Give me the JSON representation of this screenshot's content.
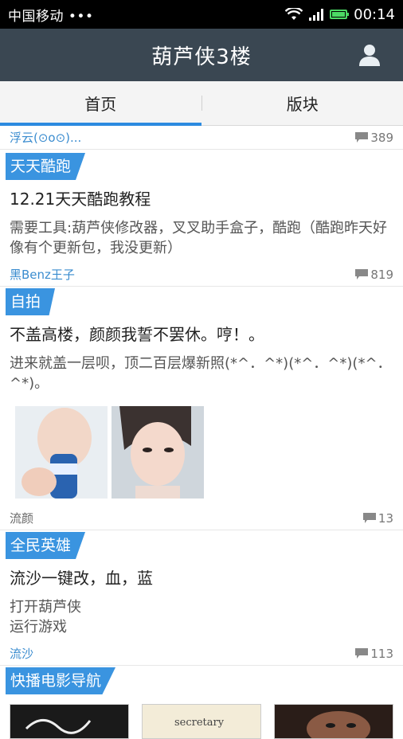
{
  "status_bar": {
    "carrier": "中国移动 •••",
    "time": "00:14"
  },
  "header": {
    "title": "葫芦侠3楼"
  },
  "tabs": [
    {
      "label": "首页"
    },
    {
      "label": "版块"
    }
  ],
  "posts": [
    {
      "author": "浮云(⊙o⊙)...",
      "comments": "389",
      "tag": "天天酷跑",
      "title": "12.21天天酷跑教程",
      "body": "需要工具:葫芦侠修改器，叉叉助手盒子，酷跑（酷跑昨天好像有个更新包，我没更新）"
    },
    {
      "author": "黑Benz王子",
      "comments": "819",
      "tag": "自拍",
      "title": "不盖高楼，颜颜我誓不罢休。哼！。",
      "body": "进来就盖一层呗，顶二百层爆新照(*^．^*)(*^．^*)(*^．^*)。"
    },
    {
      "author": "流颜",
      "comments": "13",
      "tag": "全民英雄",
      "title": "流沙一键改，血，蓝",
      "body_lines": [
        "打开葫芦侠",
        "运行游戏"
      ]
    },
    {
      "author": "流沙",
      "comments": "113",
      "tag": "快播电影导航"
    }
  ],
  "thumb_texts": [
    "secretary"
  ],
  "colors": {
    "accent": "#3a94e0",
    "header_bg": "#3a4752",
    "author_link": "#3a8ccf"
  }
}
